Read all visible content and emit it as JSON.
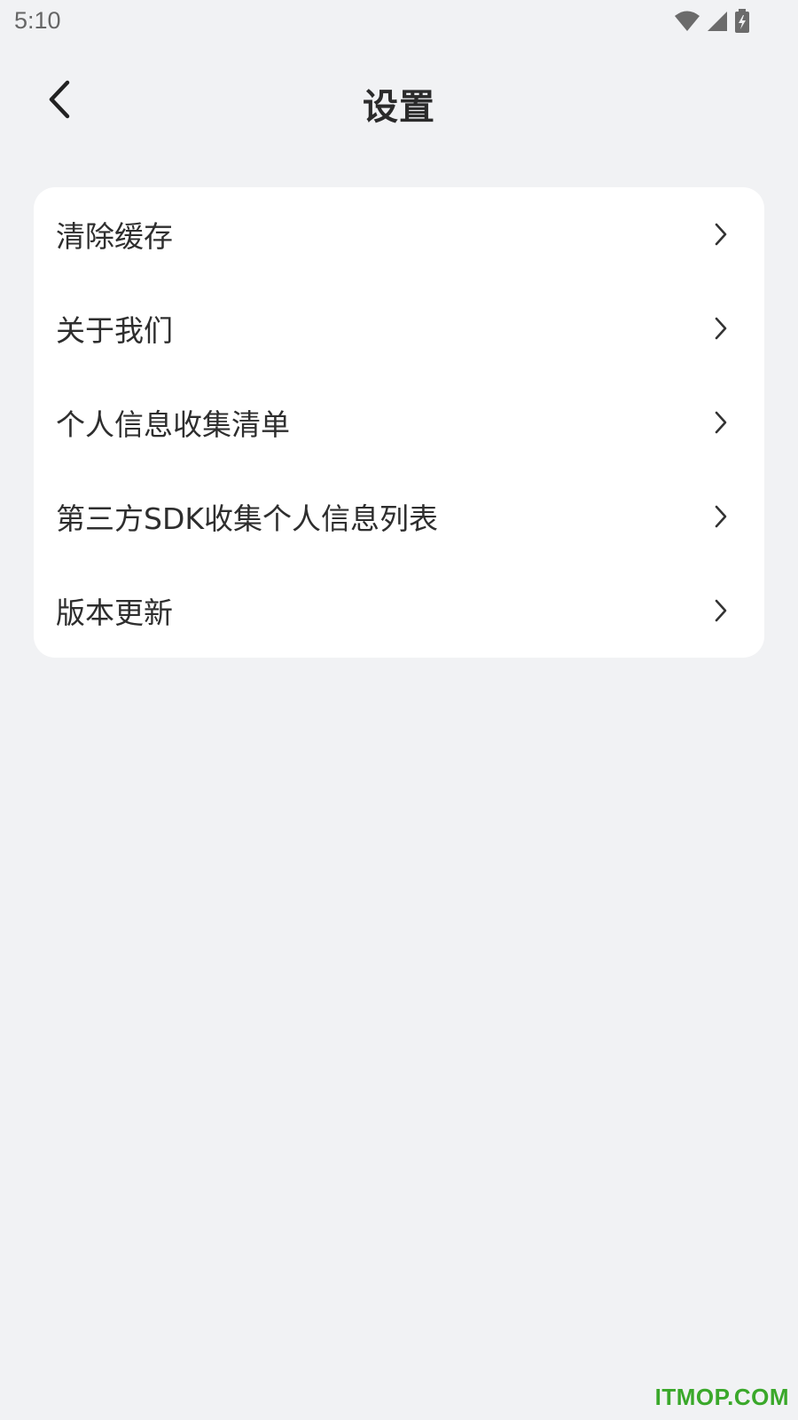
{
  "status_bar": {
    "time": "5:10",
    "icons": [
      "wifi-icon",
      "signal-icon",
      "battery-charging-icon"
    ]
  },
  "header": {
    "title": "设置",
    "back_icon": "chevron-left-icon"
  },
  "menu": {
    "items": [
      {
        "label": "清除缓存"
      },
      {
        "label": "关于我们"
      },
      {
        "label": "个人信息收集清单"
      },
      {
        "label": "第三方SDK收集个人信息列表"
      },
      {
        "label": "版本更新"
      }
    ],
    "arrow_icon": "chevron-right-icon"
  },
  "watermark": {
    "text": "ITMOP.COM",
    "color": "#3aa82a"
  },
  "colors": {
    "background": "#f1f2f4",
    "card": "#ffffff",
    "text": "#2e2e2e"
  }
}
